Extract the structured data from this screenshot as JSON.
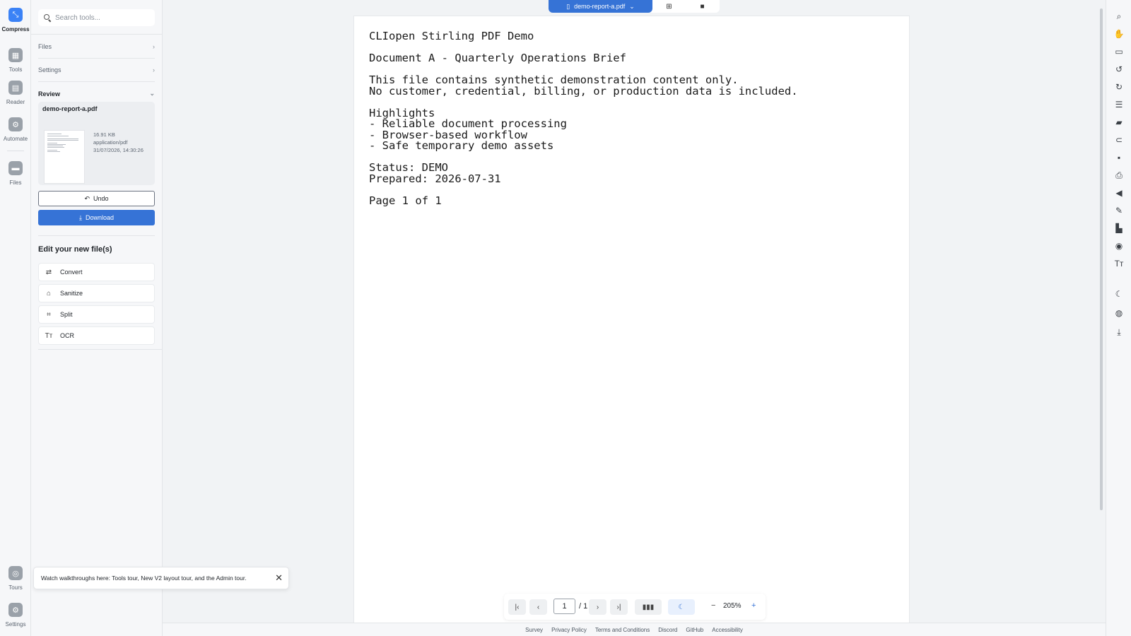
{
  "rail": {
    "compress": "Compress",
    "tools": "Tools",
    "reader": "Reader",
    "automate": "Automate",
    "files": "Files",
    "tours": "Tours",
    "settings": "Settings"
  },
  "panel": {
    "search_placeholder": "Search tools...",
    "files": "Files",
    "settings": "Settings",
    "review": "Review",
    "file_name": "demo-report-a.pdf",
    "file_size": "16.91 KB",
    "file_type": "application/pdf",
    "file_date": "31/07/2026, 14:30:26",
    "undo": "Undo",
    "download": "Download",
    "edit_title": "Edit your new file(s)",
    "edit_items": [
      "Convert",
      "Sanitize",
      "Split",
      "OCR"
    ]
  },
  "toast": {
    "message": "Watch walkthroughs here: Tools tour, New V2 layout tour, and the Admin tour."
  },
  "filebar": {
    "file": "demo-report-a.pdf"
  },
  "document": {
    "lines": [
      "CLIopen Stirling PDF Demo",
      "",
      "Document A - Quarterly Operations Brief",
      "",
      "This file contains synthetic demonstration content only.",
      "No customer, credential, billing, or production data is included.",
      "",
      "Highlights",
      "- Reliable document processing",
      "- Browser-based workflow",
      "- Safe temporary demo assets",
      "",
      "Status: DEMO",
      "Prepared: 2026-07-31",
      "",
      "Page 1 of 1"
    ]
  },
  "nav": {
    "page": "1",
    "total": "/ 1",
    "zoom": "205%"
  },
  "footer": [
    "Survey",
    "Privacy Policy",
    "Terms and Conditions",
    "Discord",
    "GitHub",
    "Accessibility"
  ],
  "colors": {
    "accent": "#3673d6"
  }
}
